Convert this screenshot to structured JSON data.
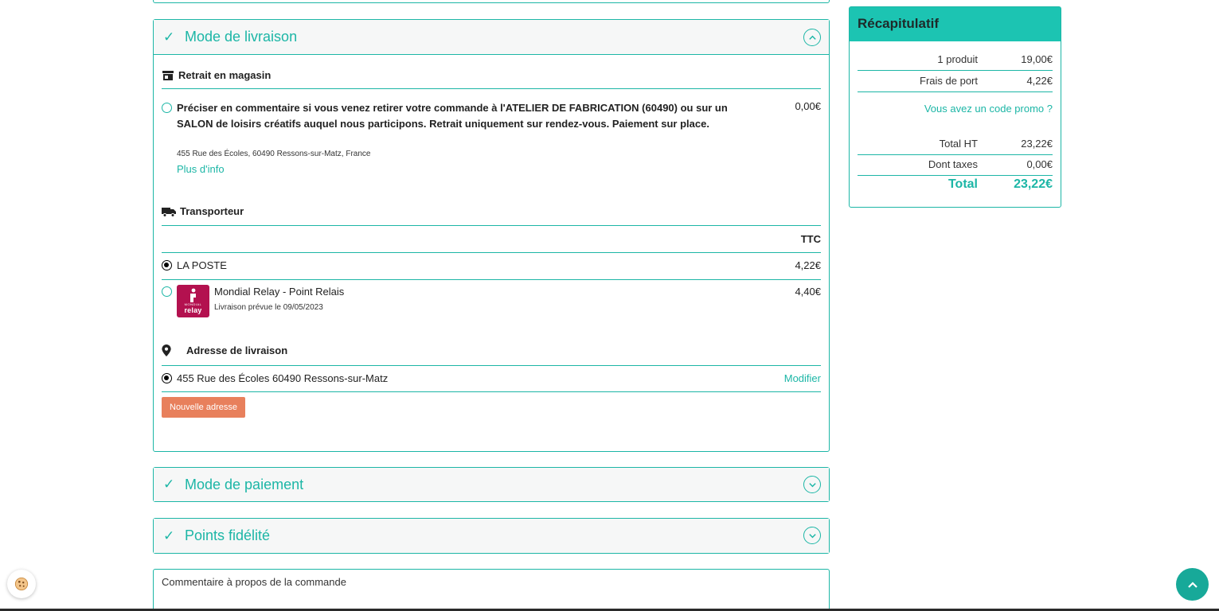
{
  "delivery": {
    "title": "Mode de livraison",
    "store_pickup": {
      "heading": "Retrait en magasin",
      "option_text": "Préciser en commentaire si vous venez retirer votre commande à l'ATELIER DE FABRICATION (60490) ou sur un SALON de loisirs créatifs auquel nous participons. Retrait uniquement sur rendez-vous. Paiement sur place.",
      "address": "455 Rue des Écoles, 60490 Ressons-sur-Matz, France",
      "more_info": "Plus d'info",
      "price": "0,00€",
      "selected": false
    },
    "carrier": {
      "heading": "Transporteur",
      "column_header": "TTC",
      "options": [
        {
          "name": "LA POSTE",
          "price": "4,22€",
          "selected": true
        },
        {
          "name": "Mondial Relay - Point Relais",
          "subtitle": "Livraison prévue le 09/05/2023",
          "price": "4,40€",
          "selected": false,
          "logo_text": "relay",
          "logo_small_text": "MONDIAL"
        }
      ]
    },
    "address": {
      "heading": "Adresse de livraison",
      "selected_address": "455 Rue des Écoles 60490 Ressons-sur-Matz",
      "edit_label": "Modifier",
      "new_address_label": "Nouvelle adresse"
    }
  },
  "payment": {
    "title": "Mode de paiement"
  },
  "loyalty": {
    "title": "Points fidélité"
  },
  "comment": {
    "label": "Commentaire à propos de la commande"
  },
  "summary": {
    "title": "Récapitulatif",
    "products_label": "1 produit",
    "products_value": "19,00€",
    "shipping_label": "Frais de port",
    "shipping_value": "4,22€",
    "promo_link": "Vous avez un code promo ?",
    "total_ht_label": "Total HT",
    "total_ht_value": "23,22€",
    "taxes_label": "Dont taxes",
    "taxes_value": "0,00€",
    "total_label": "Total",
    "total_value": "23,22€"
  },
  "colors": {
    "accent": "#1cb6a6",
    "header_fill": "#1cc4b2",
    "button_orange": "#e8805c",
    "relay": "#b3114f"
  },
  "icons": [
    "check-icon",
    "chevron-up-icon",
    "chevron-down-icon",
    "store-icon",
    "truck-icon",
    "map-pin-icon",
    "cookie-icon",
    "arrow-up-icon"
  ]
}
